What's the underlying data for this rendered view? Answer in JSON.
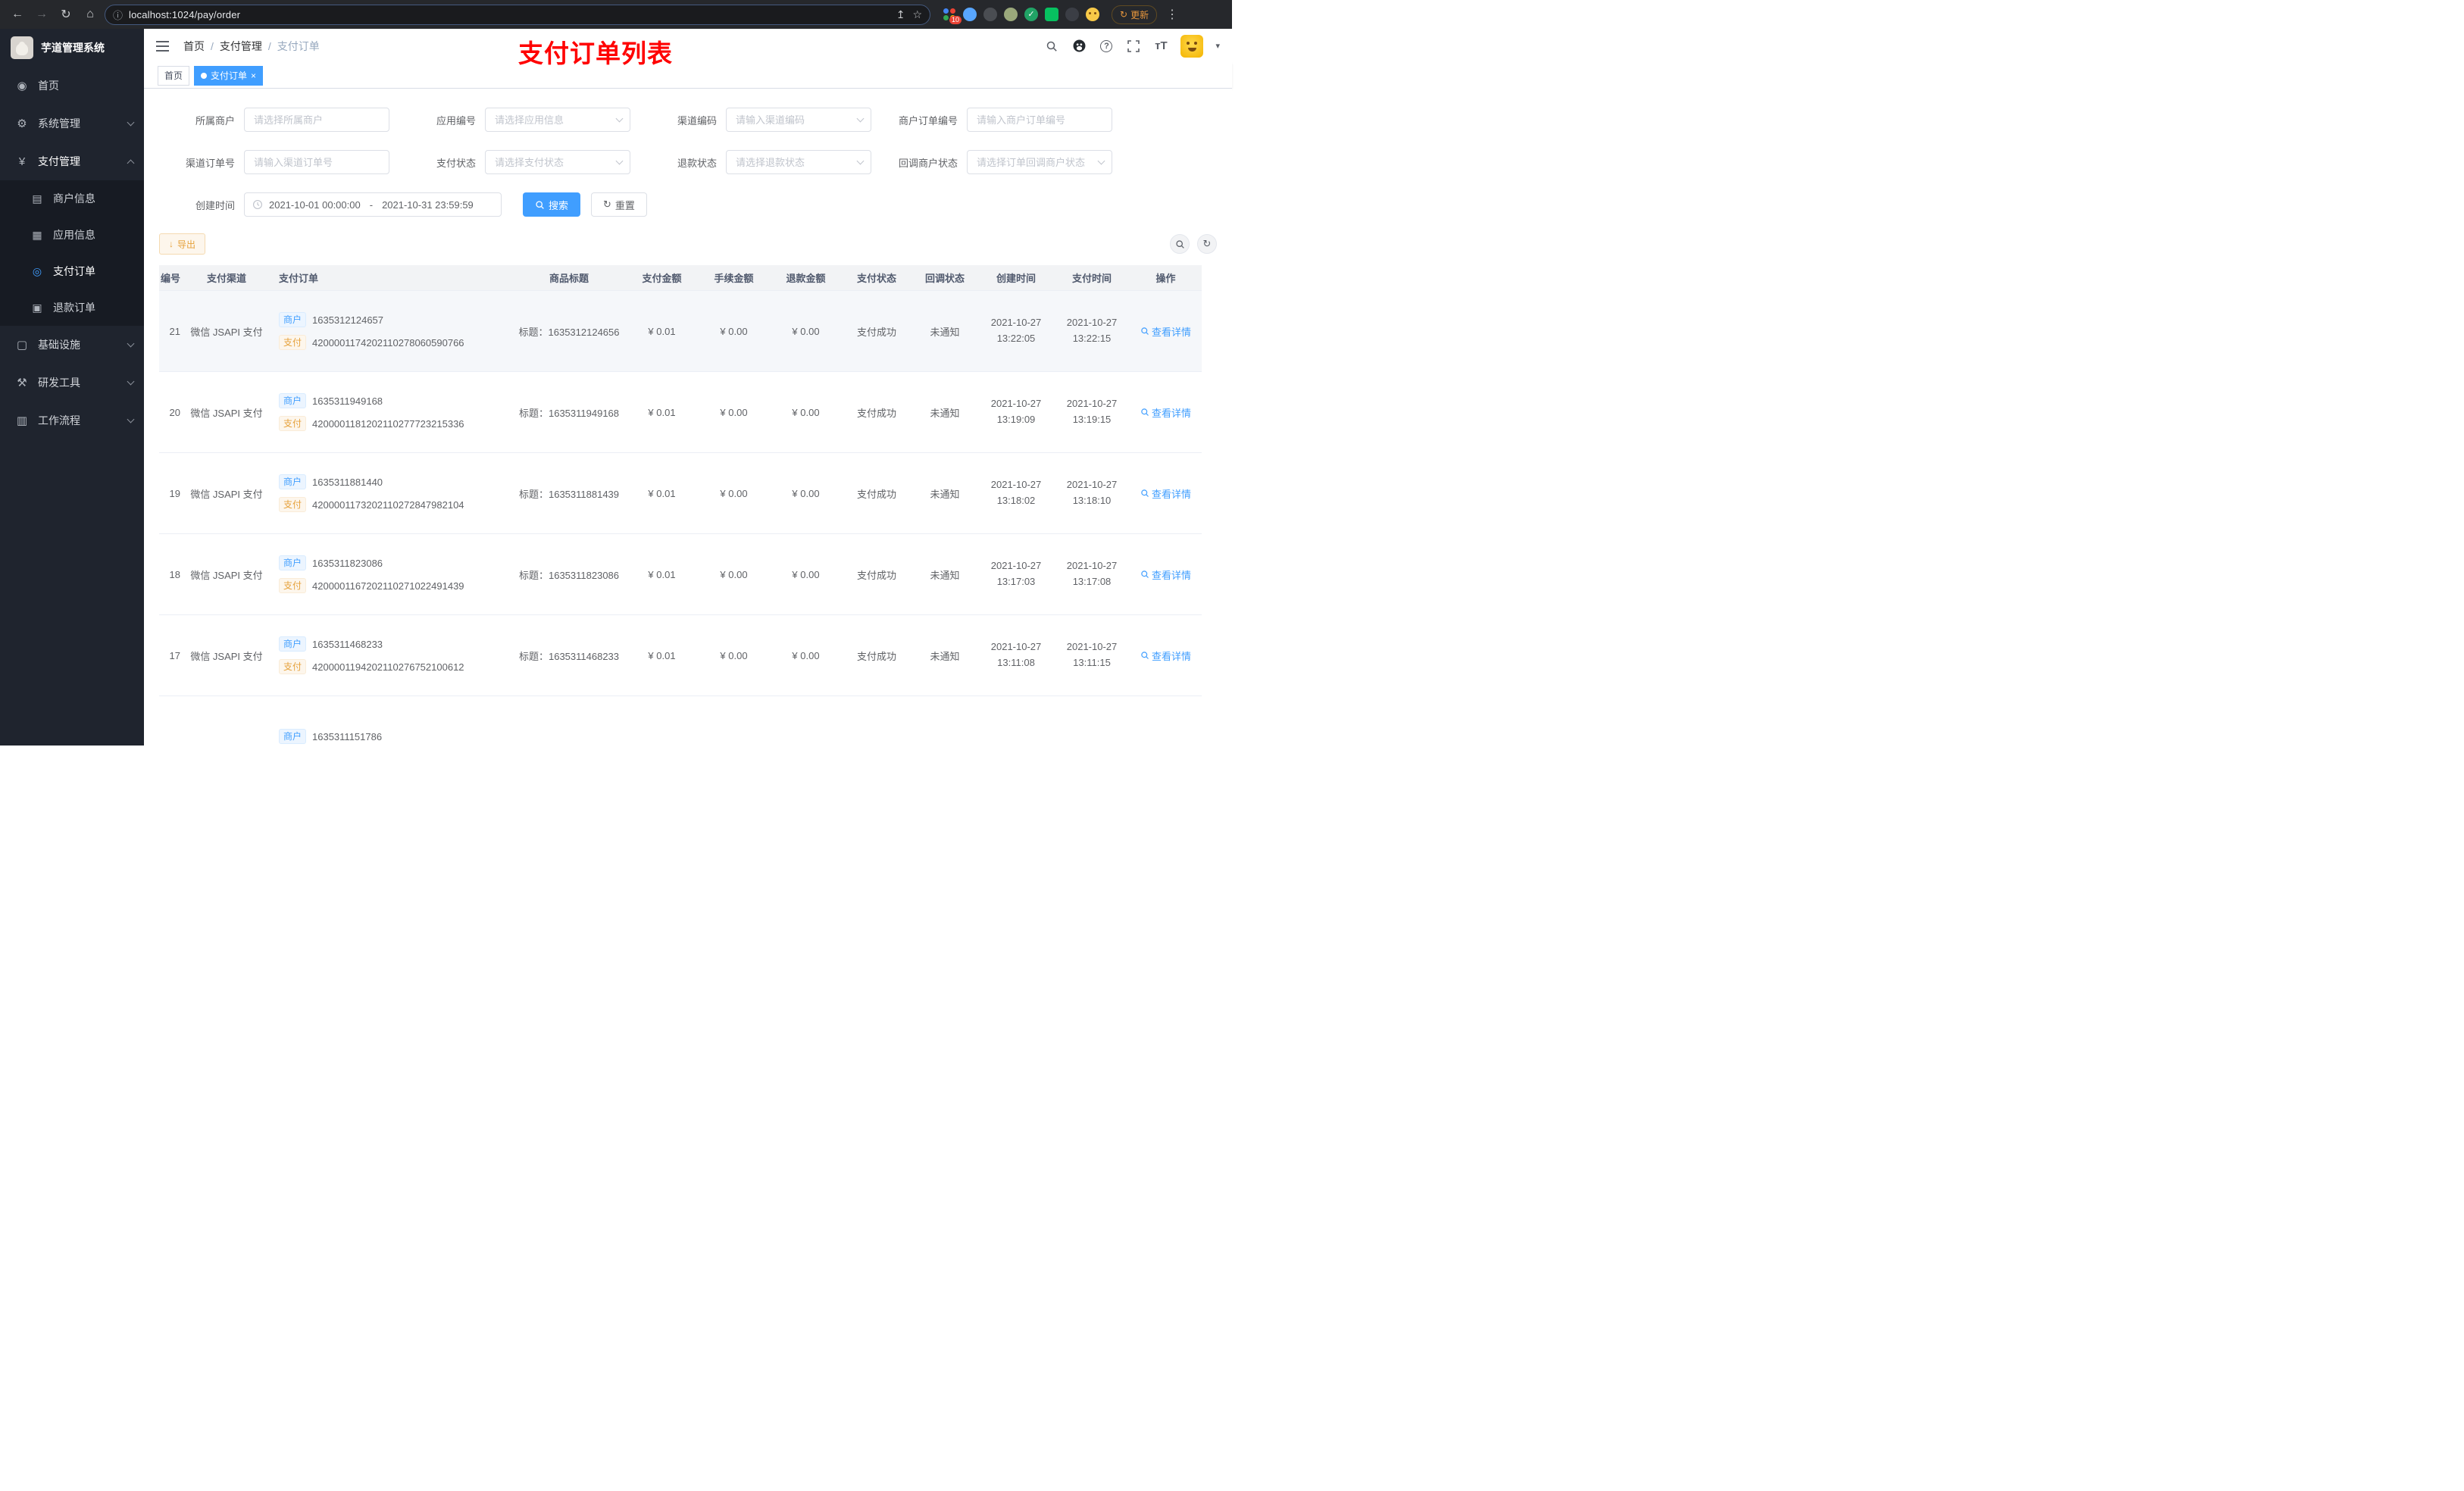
{
  "browser": {
    "url": "localhost:1024/pay/order",
    "update_label": "更新",
    "extension_badge": "10"
  },
  "icons": {
    "back": "←",
    "forward": "→",
    "reload": "↻",
    "home": "⌂",
    "info": "ⓘ",
    "share": "↥",
    "star": "☆",
    "menu_dots": "⋮",
    "breadcrumb_sep": "/",
    "refresh": "↻",
    "download": "↓",
    "caret_down": "▾",
    "close": "×",
    "help": "?",
    "font_size": "тT",
    "check": "✓"
  },
  "sidebar": {
    "logo_title": "芋道管理系统",
    "items": [
      {
        "label": "首页",
        "glyph": "◉"
      },
      {
        "label": "系统管理",
        "glyph": "⚙"
      },
      {
        "label": "支付管理",
        "glyph": "¥",
        "children": [
          {
            "label": "商户信息",
            "glyph": "▤"
          },
          {
            "label": "应用信息",
            "glyph": "▦"
          },
          {
            "label": "支付订单",
            "glyph": "◎"
          },
          {
            "label": "退款订单",
            "glyph": "▣"
          }
        ]
      },
      {
        "label": "基础设施",
        "glyph": "▢"
      },
      {
        "label": "研发工具",
        "glyph": "⚒"
      },
      {
        "label": "工作流程",
        "glyph": "▥"
      }
    ]
  },
  "header": {
    "breadcrumb": [
      "首页",
      "支付管理",
      "支付订单"
    ],
    "annotation": "支付订单列表"
  },
  "tabs": [
    {
      "label": "首页"
    },
    {
      "label": "支付订单"
    }
  ],
  "filters": {
    "fields": [
      {
        "label": "所属商户",
        "placeholder": "请选择所属商户"
      },
      {
        "label": "应用编号",
        "placeholder": "请选择应用信息"
      },
      {
        "label": "渠道编码",
        "placeholder": "请输入渠道编码"
      },
      {
        "label": "商户订单编号",
        "placeholder": "请输入商户订单编号"
      },
      {
        "label": "渠道订单号",
        "placeholder": "请输入渠道订单号"
      },
      {
        "label": "支付状态",
        "placeholder": "请选择支付状态"
      },
      {
        "label": "退款状态",
        "placeholder": "请选择退款状态"
      },
      {
        "label": "回调商户状态",
        "placeholder": "请选择订单回调商户状态"
      }
    ],
    "date": {
      "label": "创建时间",
      "start": "2021-10-01 00:00:00",
      "separator": "-",
      "end": "2021-10-31 23:59:59"
    },
    "search_label": "搜索",
    "reset_label": "重置"
  },
  "toolbar": {
    "export_label": "导出"
  },
  "table": {
    "columns": [
      "编号",
      "支付渠道",
      "支付订单",
      "商品标题",
      "支付金额",
      "手续金额",
      "退款金额",
      "支付状态",
      "回调状态",
      "创建时间",
      "支付时间",
      "操作"
    ],
    "tag_merchant": "商户",
    "tag_pay": "支付",
    "rows": [
      {
        "id": "21",
        "channel": "微信 JSAPI 支付",
        "merchant_no": "1635312124657",
        "channel_no": "4200001174202110278060590766",
        "title": "标题：1635312124656",
        "amount": "¥ 0.01",
        "fee": "¥ 0.00",
        "refund": "¥ 0.00",
        "status": "支付成功",
        "notify": "未通知",
        "create_date": "2021-10-27",
        "create_time": "13:22:05",
        "pay_date": "2021-10-27",
        "pay_time": "13:22:15",
        "action": "查看详情"
      },
      {
        "id": "20",
        "channel": "微信 JSAPI 支付",
        "merchant_no": "1635311949168",
        "channel_no": "4200001181202110277723215336",
        "title": "标题：1635311949168",
        "amount": "¥ 0.01",
        "fee": "¥ 0.00",
        "refund": "¥ 0.00",
        "status": "支付成功",
        "notify": "未通知",
        "create_date": "2021-10-27",
        "create_time": "13:19:09",
        "pay_date": "2021-10-27",
        "pay_time": "13:19:15",
        "action": "查看详情"
      },
      {
        "id": "19",
        "channel": "微信 JSAPI 支付",
        "merchant_no": "1635311881440",
        "channel_no": "4200001173202110272847982104",
        "title": "标题：1635311881439",
        "amount": "¥ 0.01",
        "fee": "¥ 0.00",
        "refund": "¥ 0.00",
        "status": "支付成功",
        "notify": "未通知",
        "create_date": "2021-10-27",
        "create_time": "13:18:02",
        "pay_date": "2021-10-27",
        "pay_time": "13:18:10",
        "action": "查看详情"
      },
      {
        "id": "18",
        "channel": "微信 JSAPI 支付",
        "merchant_no": "1635311823086",
        "channel_no": "4200001167202110271022491439",
        "title": "标题：1635311823086",
        "amount": "¥ 0.01",
        "fee": "¥ 0.00",
        "refund": "¥ 0.00",
        "status": "支付成功",
        "notify": "未通知",
        "create_date": "2021-10-27",
        "create_time": "13:17:03",
        "pay_date": "2021-10-27",
        "pay_time": "13:17:08",
        "action": "查看详情"
      },
      {
        "id": "17",
        "channel": "微信 JSAPI 支付",
        "merchant_no": "1635311468233",
        "channel_no": "4200001194202110276752100612",
        "title": "标题：1635311468233",
        "amount": "¥ 0.01",
        "fee": "¥ 0.00",
        "refund": "¥ 0.00",
        "status": "支付成功",
        "notify": "未通知",
        "create_date": "2021-10-27",
        "create_time": "13:11:08",
        "pay_date": "2021-10-27",
        "pay_time": "13:11:15",
        "action": "查看详情"
      },
      {
        "id": "",
        "channel": "",
        "merchant_no": "1635311151786",
        "channel_no": "",
        "title": "",
        "amount": "",
        "fee": "",
        "refund": "",
        "status": "",
        "notify": "",
        "create_date": "",
        "create_time": "",
        "pay_date": "",
        "pay_time": ""
      }
    ]
  },
  "colors": {
    "accent": "#409eff",
    "warning": "#e6a23c",
    "annotation_red": "#ff0000",
    "sidebar_bg": "#1f242e"
  }
}
